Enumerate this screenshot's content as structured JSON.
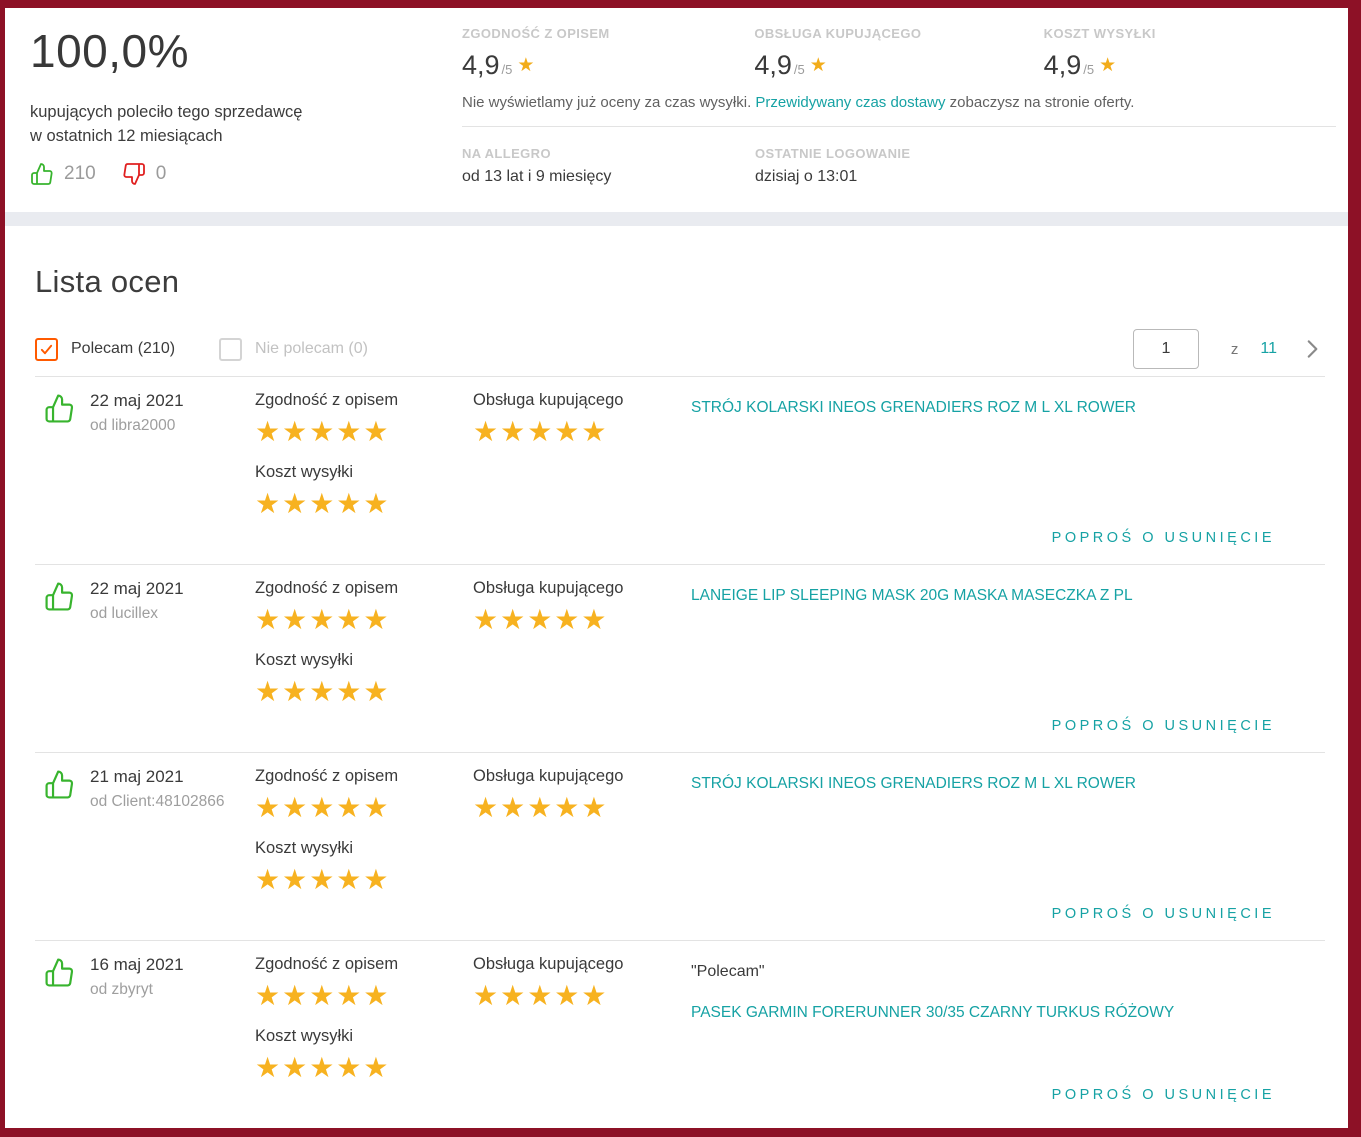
{
  "icons": {
    "star": "★"
  },
  "colors": {
    "frame_maroon": "#8d1126",
    "accent_teal": "#16a2a4",
    "star_gold": "#f7b220",
    "thumb_green": "#38b42e",
    "thumb_red": "#e02020",
    "checkbox_orange": "#ff5a00",
    "band_gray": "#e9ebf0"
  },
  "header": {
    "percent": "100,0%",
    "subtitle_line1": "kupujących poleciło tego sprzedawcę",
    "subtitle_line2": "w ostatnich 12 miesiącach",
    "thumbs_up_count": "210",
    "thumbs_down_count": "0",
    "ratings": [
      {
        "label": "ZGODNOŚĆ Z OPISEM",
        "value": "4,9",
        "suffix": "/5"
      },
      {
        "label": "OBSŁUGA KUPUJĄCEGO",
        "value": "4,9",
        "suffix": "/5"
      },
      {
        "label": "KOSZT WYSYŁKI",
        "value": "4,9",
        "suffix": "/5"
      }
    ],
    "note": {
      "before": "Nie wyświetlamy już oceny za czas wysyłki. ",
      "link": "Przewidywany czas dostawy",
      "after": " zobaczysz na stronie oferty."
    },
    "na_allegro": {
      "label": "NA ALLEGRO",
      "value": "od 13 lat i 9 miesięcy"
    },
    "last_login": {
      "label": "OSTATNIE LOGOWANIE",
      "value": "dzisiaj o 13:01"
    }
  },
  "list": {
    "title": "Lista ocen",
    "filters": [
      {
        "label": "Polecam (210)",
        "checked": true
      },
      {
        "label": "Nie polecam (0)",
        "checked": false
      }
    ],
    "pagination": {
      "current": "1",
      "separator": "z",
      "total": "11"
    }
  },
  "review_labels": {
    "zgodnosc": "Zgodność z opisem",
    "koszt": "Koszt wysyłki",
    "obsluga": "Obsługa kupującego",
    "remove": "POPROŚ O USUNIĘCIE"
  },
  "reviews": [
    {
      "date": "22 maj 2021",
      "author": "od libra2000",
      "ratings": {
        "zgodnosc": 5,
        "koszt": 5,
        "obsluga": 5
      },
      "product": "STRÓJ KOLARSKI INEOS GRENADIERS ROZ M L XL ROWER"
    },
    {
      "date": "22 maj 2021",
      "author": "od lucillex",
      "ratings": {
        "zgodnosc": 5,
        "koszt": 5,
        "obsluga": 5
      },
      "product": "LANEIGE LIP SLEEPING MASK 20G MASKA MASECZKA Z PL"
    },
    {
      "date": "21 maj 2021",
      "author": "od Client:48102866",
      "ratings": {
        "zgodnosc": 5,
        "koszt": 5,
        "obsluga": 5
      },
      "product": "STRÓJ KOLARSKI INEOS GRENADIERS ROZ M L XL ROWER"
    },
    {
      "date": "16 maj 2021",
      "author": "od zbyryt",
      "ratings": {
        "zgodnosc": 5,
        "koszt": 5,
        "obsluga": 5
      },
      "comment": "\"Polecam\"",
      "product": "PASEK GARMIN FORERUNNER 30/35 CZARNY TURKUS RÓŻOWY"
    }
  ]
}
